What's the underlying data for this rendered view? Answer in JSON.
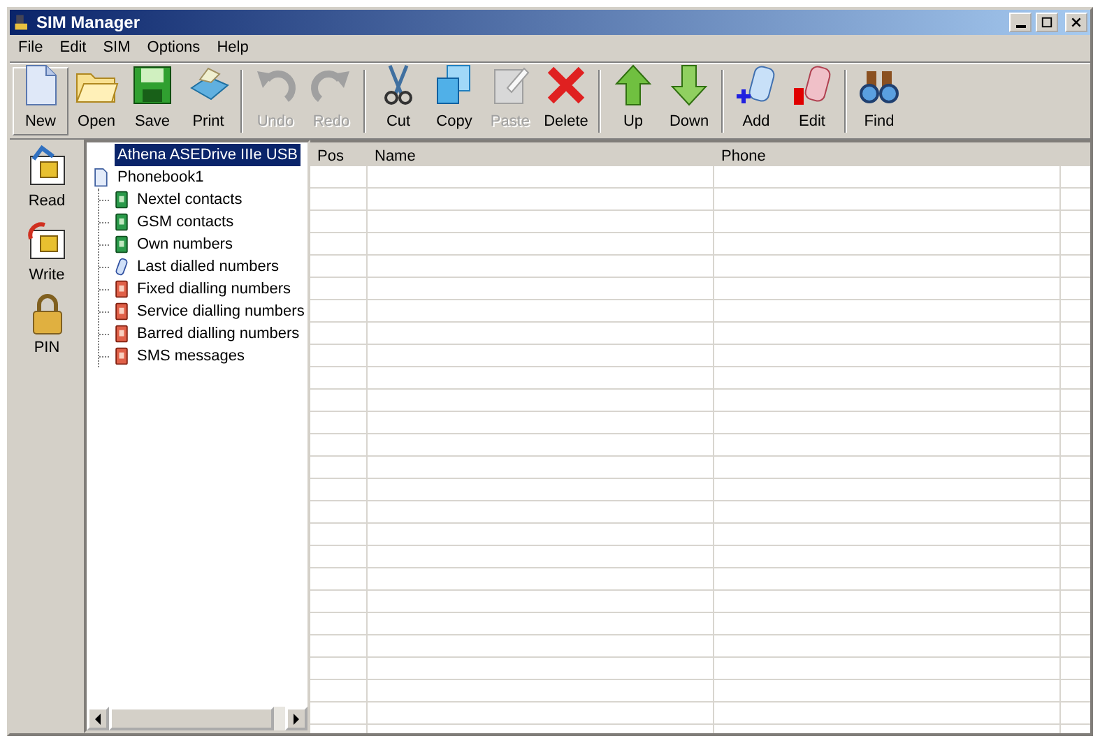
{
  "window": {
    "title": "SIM Manager"
  },
  "menu": [
    "File",
    "Edit",
    "SIM",
    "Options",
    "Help"
  ],
  "toolbar": [
    {
      "label": "New",
      "disabled": false,
      "hot": true
    },
    {
      "label": "Open",
      "disabled": false,
      "hot": false
    },
    {
      "label": "Save",
      "disabled": false,
      "hot": false
    },
    {
      "label": "Print",
      "disabled": false,
      "hot": false,
      "separator_after": true
    },
    {
      "label": "Undo",
      "disabled": true,
      "hot": false
    },
    {
      "label": "Redo",
      "disabled": true,
      "hot": false,
      "separator_after": true
    },
    {
      "label": "Cut",
      "disabled": false,
      "hot": false
    },
    {
      "label": "Copy",
      "disabled": false,
      "hot": false
    },
    {
      "label": "Paste",
      "disabled": true,
      "hot": false
    },
    {
      "label": "Delete",
      "disabled": false,
      "hot": false,
      "separator_after": true
    },
    {
      "label": "Up",
      "disabled": false,
      "hot": false
    },
    {
      "label": "Down",
      "disabled": false,
      "hot": false,
      "separator_after": true
    },
    {
      "label": "Add",
      "disabled": false,
      "hot": false
    },
    {
      "label": "Edit",
      "disabled": false,
      "hot": false,
      "separator_after": true
    },
    {
      "label": "Find",
      "disabled": false,
      "hot": false
    }
  ],
  "sidebar": {
    "items": [
      "Read",
      "Write",
      "PIN"
    ]
  },
  "tree": [
    {
      "label": "Athena ASEDrive IIIe USB",
      "selected": true,
      "kind": "reader"
    },
    {
      "label": "Phonebook1",
      "selected": false,
      "kind": "phonebook",
      "children": [
        {
          "label": "Nextel contacts",
          "selected": false,
          "kind": "contacts"
        },
        {
          "label": "GSM contacts",
          "selected": false,
          "kind": "contacts"
        },
        {
          "label": "Own numbers",
          "selected": false,
          "kind": "contacts"
        },
        {
          "label": "Last dialled numbers",
          "selected": false,
          "kind": "calls"
        },
        {
          "label": "Fixed dialling numbers",
          "selected": false,
          "kind": "restricted"
        },
        {
          "label": "Service dialling numbers",
          "selected": false,
          "kind": "restricted"
        },
        {
          "label": "Barred dialling numbers",
          "selected": false,
          "kind": "restricted"
        },
        {
          "label": "SMS messages",
          "selected": false,
          "kind": "restricted"
        }
      ]
    }
  ],
  "table": {
    "columns": [
      "Pos",
      "Name",
      "Phone"
    ]
  }
}
